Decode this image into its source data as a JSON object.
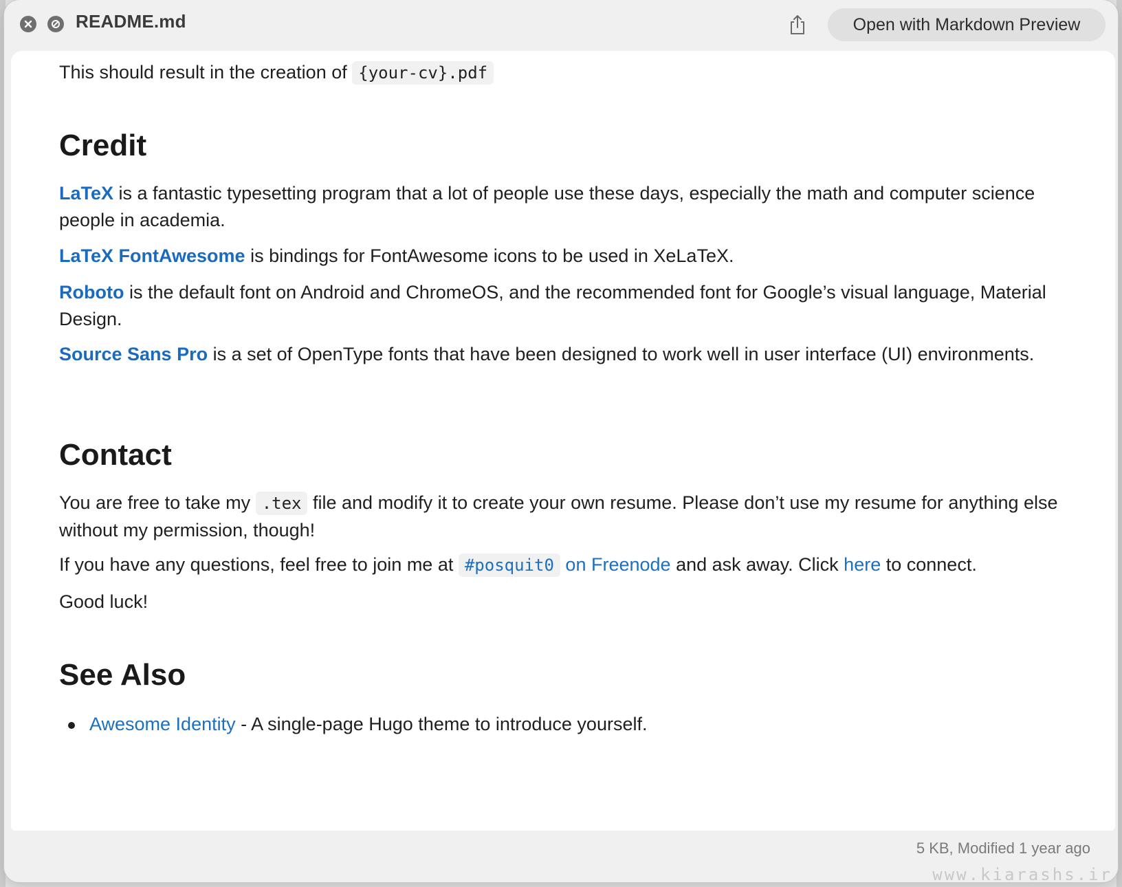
{
  "window": {
    "title": "README.md",
    "open_with_label": "Open with Markdown Preview",
    "footer_info": "5 KB, Modified 1 year ago",
    "watermark": "www.kiarashs.ir"
  },
  "icons": {
    "close": "close-icon",
    "disable": "disable-icon",
    "share": "share-icon"
  },
  "colors": {
    "link": "#1d6fbf",
    "code_bg": "#f1f1f1",
    "button_bg": "#e0e0e0"
  },
  "doc": {
    "intro": {
      "text": "This should result in the creation of",
      "code": "{your-cv}.pdf"
    },
    "credit": {
      "heading": "Credit",
      "items": [
        {
          "link": "LaTeX",
          "text": " is a fantastic typesetting program that a lot of people use these days, especially the math and computer science people in academia."
        },
        {
          "link": "LaTeX FontAwesome",
          "text": " is bindings for FontAwesome icons to be used in XeLaTeX."
        },
        {
          "link": "Roboto",
          "text": " is the default font on Android and ChromeOS, and the recommended font for Google’s visual language, Material Design."
        },
        {
          "link": "Source Sans Pro",
          "text": " is a set of OpenType fonts that have been designed to work well in user interface (UI) environments."
        }
      ]
    },
    "contact": {
      "heading": "Contact",
      "p1_before": "You are free to take my",
      "p1_code": ".tex",
      "p1_after": "file and modify it to create your own resume. Please don’t use my resume for anything else without my permission, though!",
      "p2_before": "If you have any questions, feel free to join me at",
      "p2_code": "#posquit0",
      "p2_link": "on Freenode",
      "p2_mid": "and ask away. Click",
      "p2_here": "here",
      "p2_after": "to connect.",
      "p3": "Good luck!"
    },
    "see_also": {
      "heading": "See Also",
      "items": [
        {
          "link": "Awesome Identity",
          "text": " - A single-page Hugo theme to introduce yourself."
        }
      ]
    }
  }
}
